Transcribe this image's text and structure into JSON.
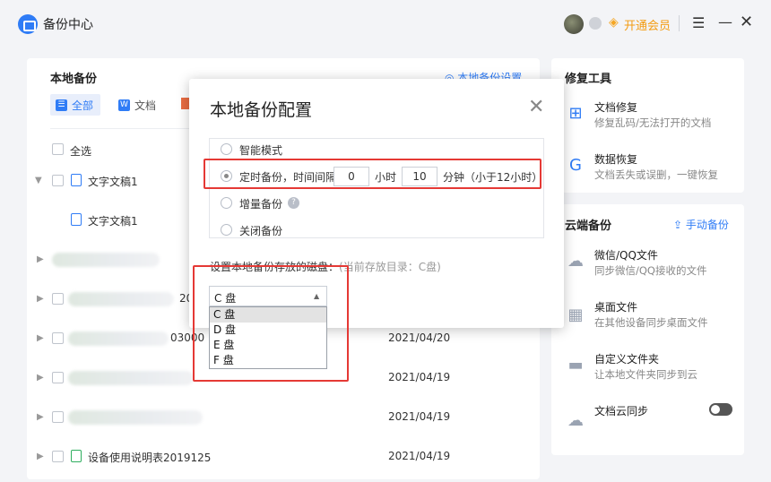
{
  "app": {
    "title": "备份中心",
    "vip_label": "开通会员"
  },
  "left": {
    "title": "本地备份",
    "settings_link": "本地备份设置",
    "filters": {
      "all": "全部",
      "doc": "文档"
    },
    "select_all": "全选",
    "rows": [
      {
        "name": "文字文稿1",
        "date": ""
      },
      {
        "name": "文字文稿1",
        "date": ""
      },
      {
        "name": "20",
        "date": ""
      },
      {
        "name": "03000",
        "date": "2021/04/20"
      },
      {
        "name": "",
        "date": "2021/04/19"
      },
      {
        "name": "",
        "date": "2021/04/19"
      },
      {
        "name": "设备使用说明表2019125",
        "date": "2021/04/19"
      }
    ]
  },
  "repair": {
    "title": "修复工具",
    "items": [
      {
        "title": "文档修复",
        "desc": "修复乱码/无法打开的文档",
        "icon": "doc-repair-icon"
      },
      {
        "title": "数据恢复",
        "desc": "文档丢失或误删，一键恢复",
        "icon": "data-recover-icon"
      }
    ]
  },
  "cloud": {
    "title": "云端备份",
    "upload_label": "手动备份",
    "items": [
      {
        "title": "微信/QQ文件",
        "desc": "同步微信/QQ接收的文件",
        "icon": "chat-icon"
      },
      {
        "title": "桌面文件",
        "desc": "在其他设备同步桌面文件",
        "icon": "windows-icon"
      },
      {
        "title": "自定义文件夹",
        "desc": "让本地文件夹同步到云",
        "icon": "folder-icon"
      },
      {
        "title": "文档云同步",
        "desc": "",
        "icon": "cloud-icon"
      }
    ]
  },
  "modal": {
    "title": "本地备份配置",
    "options": {
      "smart": "智能模式",
      "timed_prefix": "定时备份，时间间隔",
      "hours_value": "0",
      "hours_unit": "小时",
      "minutes_value": "10",
      "minutes_unit": "分钟（小于12小时）",
      "incremental": "增量备份",
      "off": "关闭备份"
    },
    "path_label": "设置本地备份存放的磁盘：",
    "path_hint": "(当前存放目录：C盘)",
    "selected_drive": "C 盘",
    "drives": [
      "C 盘",
      "D 盘",
      "E 盘",
      "F 盘"
    ]
  }
}
